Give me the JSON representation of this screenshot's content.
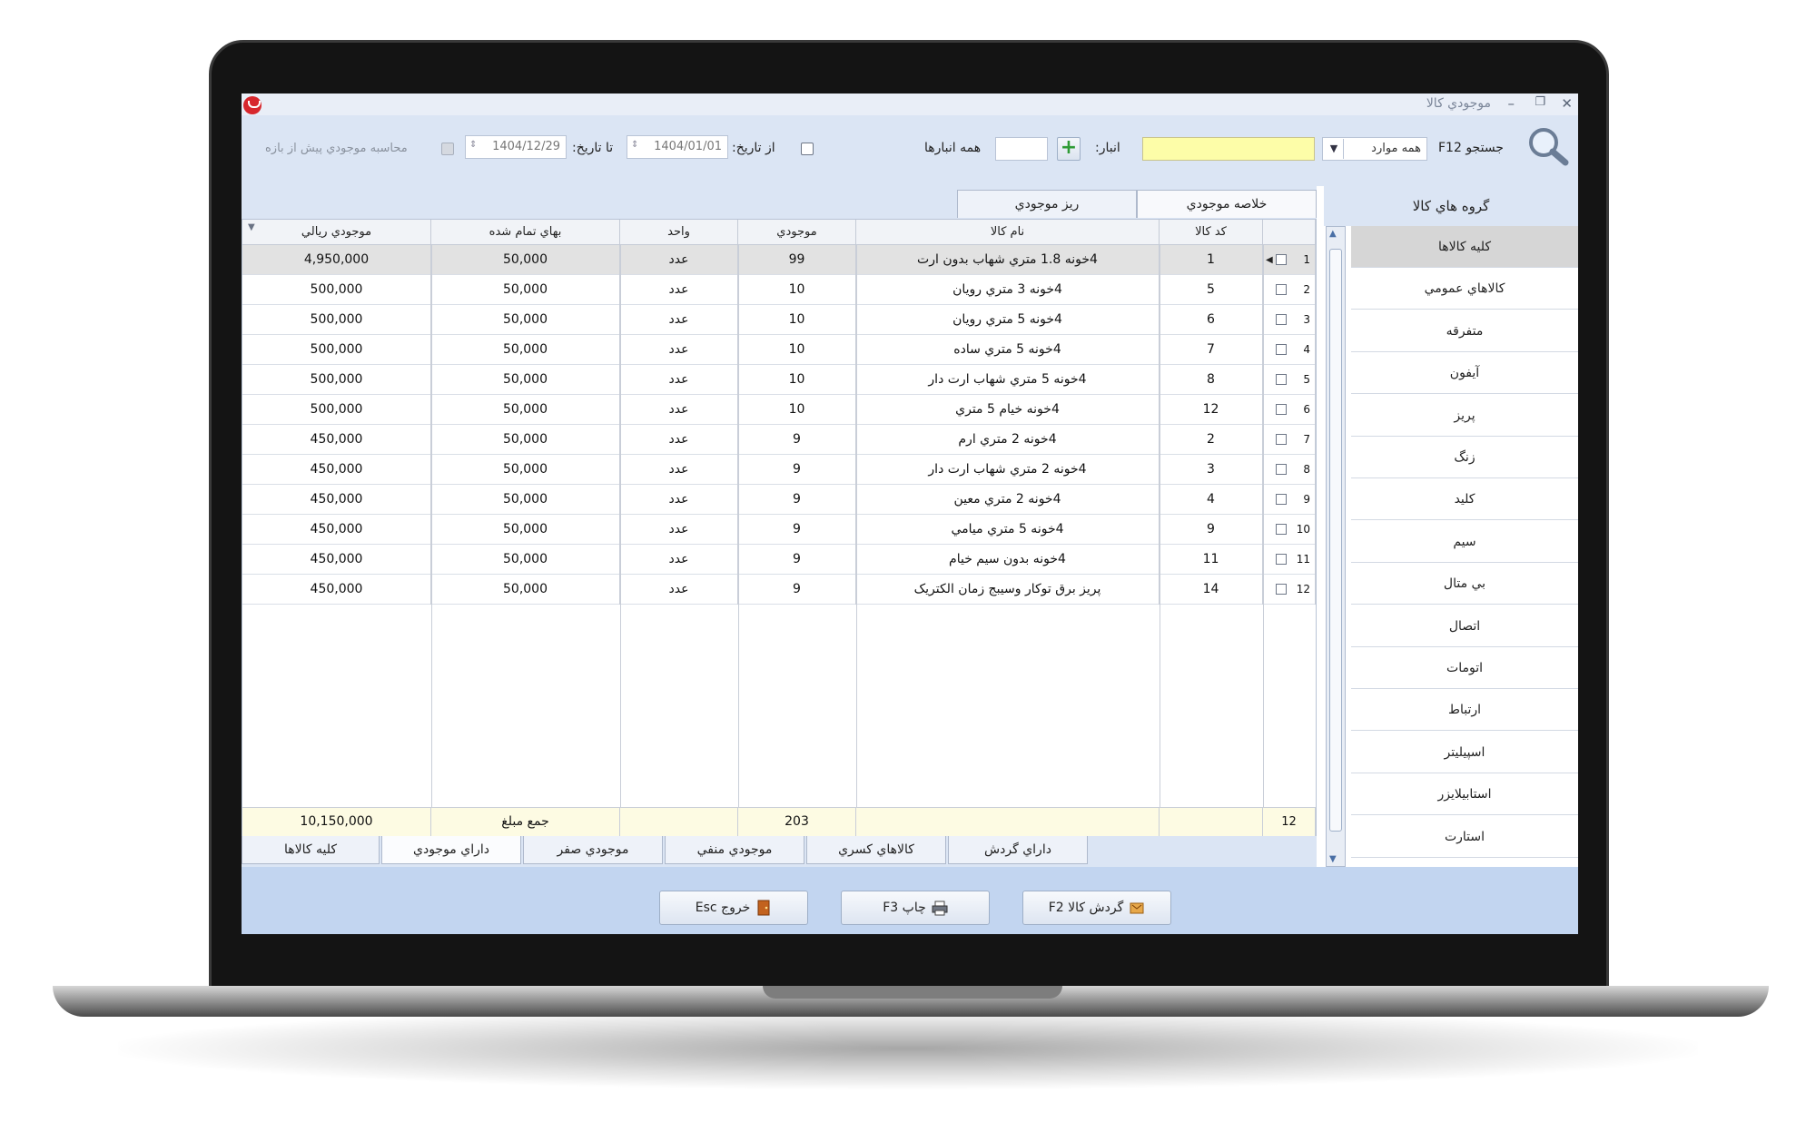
{
  "window": {
    "title": "موجودي کالا"
  },
  "toolbar": {
    "search_label": "جستجو F12",
    "filter_value": "همه موارد",
    "warehouse_label": "انبار:",
    "warehouse_value": "همه انبارها",
    "from_label": "از تاريخ:",
    "from_date": "1404/01/01",
    "to_label": "تا تاريخ:",
    "to_date": "1404/12/29",
    "calc_label": "محاسبه موجودي پيش از بازه"
  },
  "top_tabs": [
    "خلاصه موجودي",
    "ريز موجودي"
  ],
  "columns": [
    "كد كالا",
    "نام كالا",
    "موجودي",
    "واحد",
    "بهاي تمام شده",
    "موجودي ريالي"
  ],
  "rows": [
    {
      "n": "1",
      "code": "1",
      "name": "4خونه 1.8 متري شهاب بدون ارت",
      "qty": "99",
      "unit": "عدد",
      "price": "50,000",
      "total": "4,950,000"
    },
    {
      "n": "2",
      "code": "5",
      "name": "4خونه 3 متري رويان",
      "qty": "10",
      "unit": "عدد",
      "price": "50,000",
      "total": "500,000"
    },
    {
      "n": "3",
      "code": "6",
      "name": "4خونه 5 متري رويان",
      "qty": "10",
      "unit": "عدد",
      "price": "50,000",
      "total": "500,000"
    },
    {
      "n": "4",
      "code": "7",
      "name": "4خونه 5 متري ساده",
      "qty": "10",
      "unit": "عدد",
      "price": "50,000",
      "total": "500,000"
    },
    {
      "n": "5",
      "code": "8",
      "name": "4خونه 5 متري شهاب ارت دار",
      "qty": "10",
      "unit": "عدد",
      "price": "50,000",
      "total": "500,000"
    },
    {
      "n": "6",
      "code": "12",
      "name": "4خونه خيام 5 متري",
      "qty": "10",
      "unit": "عدد",
      "price": "50,000",
      "total": "500,000"
    },
    {
      "n": "7",
      "code": "2",
      "name": "4خونه 2 متري ارم",
      "qty": "9",
      "unit": "عدد",
      "price": "50,000",
      "total": "450,000"
    },
    {
      "n": "8",
      "code": "3",
      "name": "4خونه 2 متري شهاب ارت دار",
      "qty": "9",
      "unit": "عدد",
      "price": "50,000",
      "total": "450,000"
    },
    {
      "n": "9",
      "code": "4",
      "name": "4خونه 2 متري معين",
      "qty": "9",
      "unit": "عدد",
      "price": "50,000",
      "total": "450,000"
    },
    {
      "n": "10",
      "code": "9",
      "name": "4خونه 5 متري ميامي",
      "qty": "9",
      "unit": "عدد",
      "price": "50,000",
      "total": "450,000"
    },
    {
      "n": "11",
      "code": "11",
      "name": "4خونه بدون سيم خيام",
      "qty": "9",
      "unit": "عدد",
      "price": "50,000",
      "total": "450,000"
    },
    {
      "n": "12",
      "code": "14",
      "name": "پريز برق توكار وسيبج زمان الكتريک",
      "qty": "9",
      "unit": "عدد",
      "price": "50,000",
      "total": "450,000"
    }
  ],
  "footer": {
    "count": "12",
    "qty_sum": "203",
    "sum_label": "جمع مبلغ",
    "total_sum": "10,150,000"
  },
  "bottom_tabs": [
    "داراي گردش",
    "كالاهاي كسري",
    "موجودي منفي",
    "موجودي صفر",
    "داراي موجودي",
    "كليه كالاها"
  ],
  "groups": {
    "header": "گروه هاي كالا",
    "items": [
      "كليه كالاها",
      "كالاهاي عمومي",
      "متفرقه",
      "آيفون",
      "پريز",
      "زنگ",
      "كليد",
      "سيم",
      "بي متال",
      "اتصال",
      "اتومات",
      "ارتباط",
      "اسپيليتر",
      "استابيلايزر",
      "استارت"
    ]
  },
  "buttons": {
    "turnover": "گردش کالا F2",
    "print": "چاپ F3",
    "exit": "خروج Esc"
  },
  "colors": {
    "accent": "#dbe5f4",
    "search_field": "#fdfda8",
    "footer_row": "#fdfbe3",
    "button_bar": "#c2d5f0"
  }
}
